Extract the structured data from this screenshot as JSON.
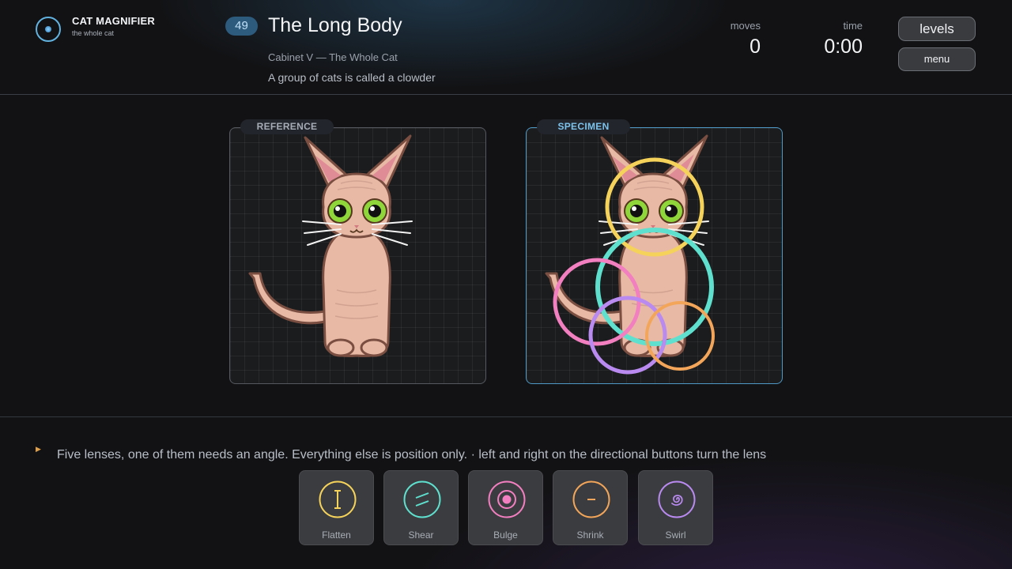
{
  "app": {
    "title": "CAT MAGNIFIER",
    "subtitle": "the whole cat"
  },
  "level": {
    "number": "49",
    "title": "The Long Body",
    "cabinet": "Cabinet V — The Whole Cat",
    "fact": "A group of cats is called a clowder"
  },
  "stats": {
    "moves_label": "moves",
    "moves_value": "0",
    "time_label": "time",
    "time_value": "0:00"
  },
  "buttons": {
    "levels": "levels",
    "menu": "menu"
  },
  "panels": {
    "reference_label": "REFERENCE",
    "specimen_label": "SPECIMEN"
  },
  "hint": {
    "text": "Five lenses, one of them needs an angle. Everything else is position only.  ·  left and right on the directional buttons turn the lens"
  },
  "lenses": [
    {
      "name": "Flatten",
      "icon": "flatten-icon",
      "color": "#f5d25a"
    },
    {
      "name": "Shear",
      "icon": "shear-icon",
      "color": "#5fe0cf"
    },
    {
      "name": "Bulge",
      "icon": "bulge-icon",
      "color": "#f27fc0"
    },
    {
      "name": "Shrink",
      "icon": "shrink-icon",
      "color": "#f3a659"
    },
    {
      "name": "Swirl",
      "icon": "swirl-icon",
      "color": "#b98af0"
    }
  ],
  "colors": {
    "accent": "#62b2e0",
    "cat_fur": "#e8b9a4",
    "cat_outline": "#7a4f42",
    "cat_eye": "#8fd63b"
  }
}
